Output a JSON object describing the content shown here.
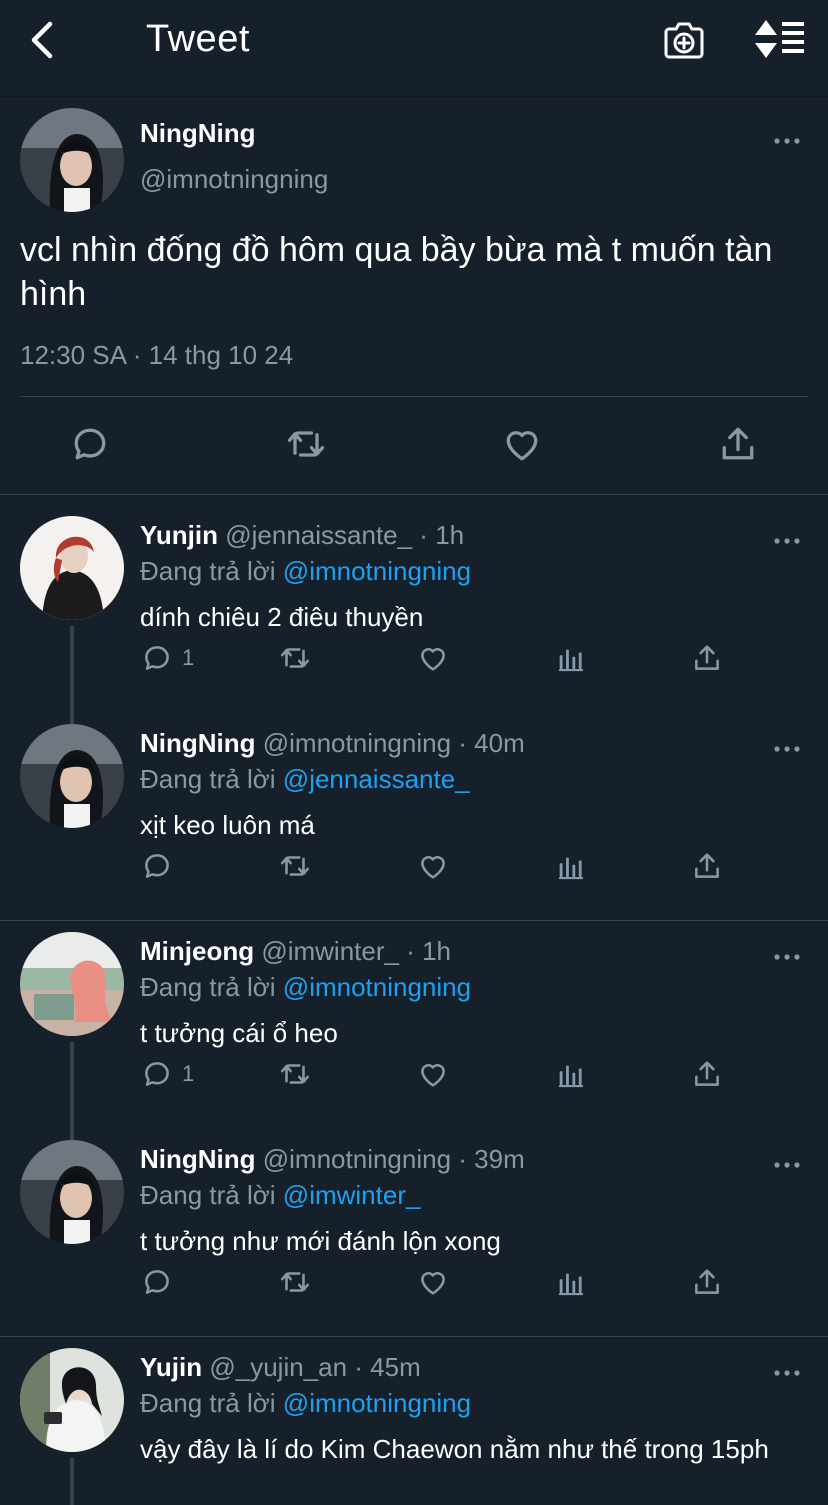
{
  "header": {
    "title": "Tweet",
    "back_icon": "chevron-left-icon",
    "camera_icon": "camera-plus-icon",
    "sort_icon": "sort-icon"
  },
  "colors": {
    "background": "#15202b",
    "secondary_text": "#8899a6",
    "link": "#1da1f2",
    "divider": "#38444d"
  },
  "main_tweet": {
    "name": "NingNing",
    "handle": "@imnotningning",
    "text": "vcl nhìn đống đồ hôm qua bầy bừa mà t muốn tàn hình",
    "timestamp": "12:30 SA · 14 thg 10 24"
  },
  "replies": [
    {
      "name": "Yunjin",
      "handle_time": "@jennaissante_ · 1h",
      "replying_label": "Đang trả lời",
      "replying_to": "@imnotningning",
      "text": "dính chiêu 2 điêu thuyền",
      "reply_count": "1"
    },
    {
      "name": "NingNing",
      "handle_time": "@imnotningning · 40m",
      "replying_label": "Đang trả lời",
      "replying_to": "@jennaissante_",
      "text": "xịt keo luôn má",
      "reply_count": ""
    },
    {
      "name": "Minjeong",
      "handle_time": "@imwinter_ · 1h",
      "replying_label": "Đang trả lời",
      "replying_to": "@imnotningning",
      "text": "t tưởng cái ổ heo",
      "reply_count": "1"
    },
    {
      "name": "NingNing",
      "handle_time": "@imnotningning · 39m",
      "replying_label": "Đang trả lời",
      "replying_to": "@imwinter_",
      "text": "t tưởng như mới đánh lộn xong",
      "reply_count": ""
    },
    {
      "name": "Yujin",
      "handle_time": "@_yujin_an · 45m",
      "replying_label": "Đang trả lời",
      "replying_to": "@imnotningning",
      "text": "vậy đây là lí do Kim Chaewon nằm như thế trong 15ph",
      "reply_count": ""
    }
  ]
}
